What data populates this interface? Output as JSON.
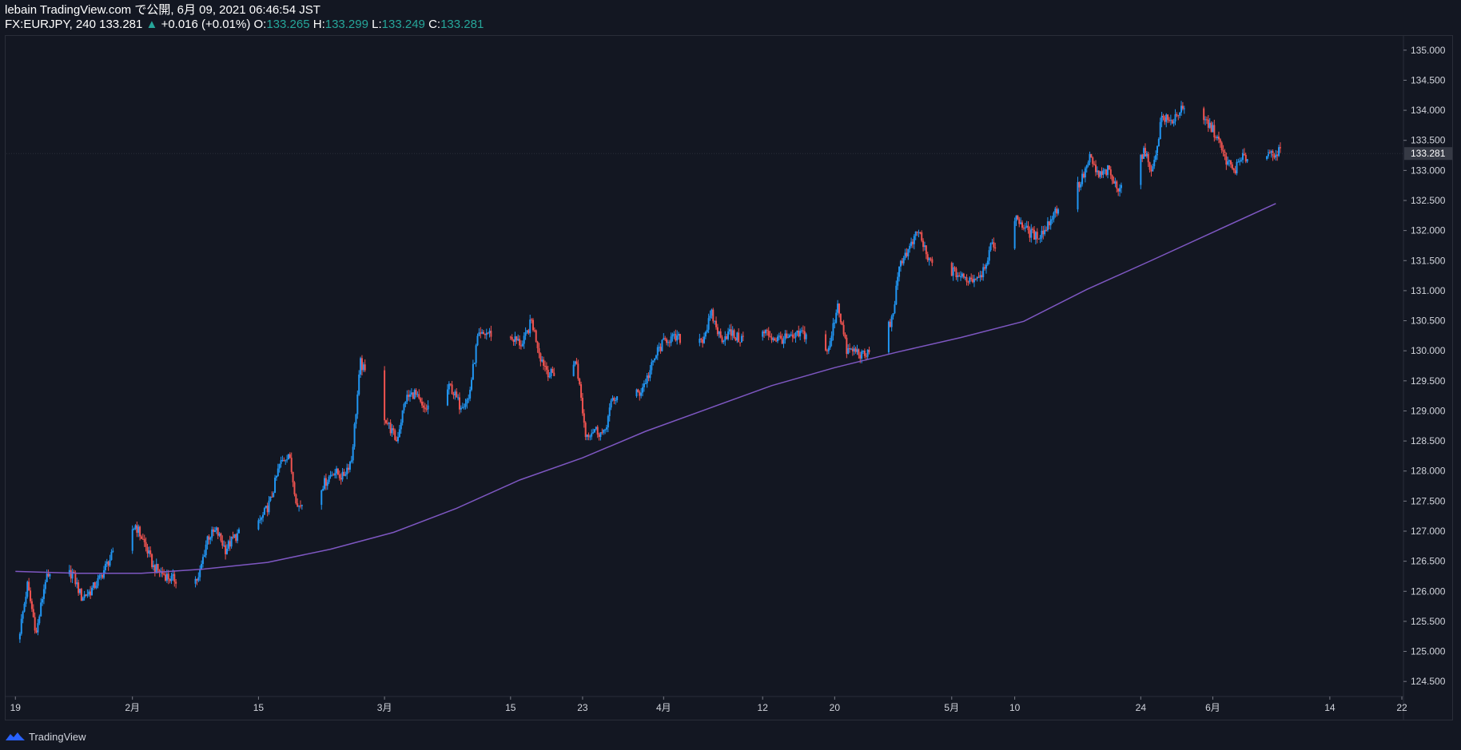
{
  "header": {
    "publish_line": "lebain TradingView.com で公開, 6月 09, 2021 06:46:54 JST",
    "symbol": "FX:EURJPY, 240",
    "last": "133.281",
    "change_arrow": "▲",
    "change": "+0.016 (+0.01%)",
    "o_label": "O:",
    "o_value": "133.265",
    "h_label": "H:",
    "h_value": "133.299",
    "l_label": "L:",
    "l_value": "133.249",
    "c_label": "C:",
    "c_value": "133.281"
  },
  "footer": {
    "brand": "TradingView",
    "logo_icon": "tradingview-logo-icon"
  },
  "colors": {
    "background": "#131722",
    "up": "#2196f3",
    "down": "#ef5350",
    "ma": "#7e57c2",
    "grid": "#1e222d",
    "text": "#d1d4dc",
    "price_label_bg": "#363a45"
  },
  "chart_data": {
    "type": "candlestick",
    "symbol": "FX:EURJPY",
    "timeframe": "240",
    "ylim": [
      124.25,
      135.25
    ],
    "y_ticks": [
      "135.000",
      "134.500",
      "134.000",
      "133.500",
      "133.000",
      "132.500",
      "132.000",
      "131.500",
      "131.000",
      "130.500",
      "130.000",
      "129.500",
      "129.000",
      "128.500",
      "128.000",
      "127.500",
      "127.000",
      "126.500",
      "126.000",
      "125.500",
      "125.000",
      "124.500"
    ],
    "x_ticks": [
      "19",
      "2月",
      "15",
      "3月",
      "15",
      "23",
      "4月",
      "12",
      "20",
      "5月",
      "10",
      "24",
      "6月",
      "14",
      "22"
    ],
    "current_price": "133.281",
    "price_path": [
      [
        "2021-01-19",
        125.2
      ],
      [
        "2021-01-20",
        126.1
      ],
      [
        "2021-01-21",
        125.3
      ],
      [
        "2021-01-22",
        126.2
      ],
      [
        "2021-01-25",
        126.3
      ],
      [
        "2021-01-26",
        125.9
      ],
      [
        "2021-01-27",
        126.0
      ],
      [
        "2021-01-28",
        126.2
      ],
      [
        "2021-01-29",
        126.5
      ],
      [
        "2021-02-01",
        127.1
      ],
      [
        "2021-02-02",
        126.8
      ],
      [
        "2021-02-03",
        126.4
      ],
      [
        "2021-02-04",
        126.3
      ],
      [
        "2021-02-05",
        126.2
      ],
      [
        "2021-02-08",
        126.2
      ],
      [
        "2021-02-09",
        126.9
      ],
      [
        "2021-02-10",
        127.0
      ],
      [
        "2021-02-11",
        126.7
      ],
      [
        "2021-02-12",
        126.9
      ],
      [
        "2021-02-15",
        127.2
      ],
      [
        "2021-02-16",
        127.5
      ],
      [
        "2021-02-17",
        128.1
      ],
      [
        "2021-02-18",
        128.3
      ],
      [
        "2021-02-19",
        127.4
      ],
      [
        "2021-02-22",
        127.8
      ],
      [
        "2021-02-23",
        128.0
      ],
      [
        "2021-02-24",
        127.9
      ],
      [
        "2021-02-25",
        128.2
      ],
      [
        "2021-02-26",
        129.8
      ],
      [
        "2021-03-01",
        128.8
      ],
      [
        "2021-03-02",
        128.5
      ],
      [
        "2021-03-03",
        129.2
      ],
      [
        "2021-03-04",
        129.3
      ],
      [
        "2021-03-05",
        129.0
      ],
      [
        "2021-03-08",
        129.4
      ],
      [
        "2021-03-09",
        129.1
      ],
      [
        "2021-03-10",
        129.2
      ],
      [
        "2021-03-11",
        130.2
      ],
      [
        "2021-03-12",
        130.3
      ],
      [
        "2021-03-15",
        130.2
      ],
      [
        "2021-03-16",
        130.1
      ],
      [
        "2021-03-17",
        130.5
      ],
      [
        "2021-03-18",
        129.9
      ],
      [
        "2021-03-19",
        129.6
      ],
      [
        "2021-03-22",
        129.8
      ],
      [
        "2021-03-23",
        128.6
      ],
      [
        "2021-03-24",
        128.7
      ],
      [
        "2021-03-25",
        128.6
      ],
      [
        "2021-03-26",
        129.2
      ],
      [
        "2021-03-29",
        129.3
      ],
      [
        "2021-03-30",
        129.6
      ],
      [
        "2021-03-31",
        130.0
      ],
      [
        "2021-04-01",
        130.2
      ],
      [
        "2021-04-02",
        130.2
      ],
      [
        "2021-04-05",
        130.2
      ],
      [
        "2021-04-06",
        130.6
      ],
      [
        "2021-04-07",
        130.2
      ],
      [
        "2021-04-08",
        130.3
      ],
      [
        "2021-04-09",
        130.2
      ],
      [
        "2021-04-12",
        130.3
      ],
      [
        "2021-04-13",
        130.2
      ],
      [
        "2021-04-14",
        130.2
      ],
      [
        "2021-04-15",
        130.2
      ],
      [
        "2021-04-16",
        130.3
      ],
      [
        "2021-04-19",
        130.0
      ],
      [
        "2021-04-20",
        130.8
      ],
      [
        "2021-04-21",
        130.0
      ],
      [
        "2021-04-22",
        130.0
      ],
      [
        "2021-04-23",
        129.9
      ],
      [
        "2021-04-26",
        130.5
      ],
      [
        "2021-04-27",
        131.5
      ],
      [
        "2021-04-28",
        131.7
      ],
      [
        "2021-04-29",
        132.0
      ],
      [
        "2021-04-30",
        131.5
      ],
      [
        "2021-05-03",
        131.3
      ],
      [
        "2021-05-04",
        131.2
      ],
      [
        "2021-05-05",
        131.2
      ],
      [
        "2021-05-06",
        131.3
      ],
      [
        "2021-05-07",
        131.7
      ],
      [
        "2021-05-10",
        132.2
      ],
      [
        "2021-05-11",
        132.0
      ],
      [
        "2021-05-12",
        131.9
      ],
      [
        "2021-05-13",
        132.0
      ],
      [
        "2021-05-14",
        132.3
      ],
      [
        "2021-05-17",
        132.8
      ],
      [
        "2021-05-18",
        133.2
      ],
      [
        "2021-05-19",
        132.9
      ],
      [
        "2021-05-20",
        133.0
      ],
      [
        "2021-05-21",
        132.7
      ],
      [
        "2021-05-24",
        133.3
      ],
      [
        "2021-05-25",
        133.0
      ],
      [
        "2021-05-26",
        133.9
      ],
      [
        "2021-05-27",
        133.8
      ],
      [
        "2021-05-28",
        134.0
      ],
      [
        "2021-05-31",
        133.8
      ],
      [
        "2021-06-01",
        133.6
      ],
      [
        "2021-06-02",
        133.2
      ],
      [
        "2021-06-03",
        133.0
      ],
      [
        "2021-06-04",
        133.2
      ],
      [
        "2021-06-07",
        133.3
      ],
      [
        "2021-06-08",
        133.3
      ]
    ],
    "moving_average": [
      [
        "2021-01-19",
        126.33
      ],
      [
        "2021-01-26",
        126.3
      ],
      [
        "2021-02-02",
        126.3
      ],
      [
        "2021-02-09",
        126.37
      ],
      [
        "2021-02-16",
        126.48
      ],
      [
        "2021-02-23",
        126.7
      ],
      [
        "2021-03-02",
        126.98
      ],
      [
        "2021-03-09",
        127.38
      ],
      [
        "2021-03-16",
        127.85
      ],
      [
        "2021-03-23",
        128.22
      ],
      [
        "2021-03-30",
        128.66
      ],
      [
        "2021-04-06",
        129.04
      ],
      [
        "2021-04-13",
        129.42
      ],
      [
        "2021-04-20",
        129.72
      ],
      [
        "2021-04-27",
        129.98
      ],
      [
        "2021-05-04",
        130.22
      ],
      [
        "2021-05-11",
        130.49
      ],
      [
        "2021-05-18",
        131.02
      ],
      [
        "2021-05-25",
        131.49
      ],
      [
        "2021-06-01",
        131.97
      ],
      [
        "2021-06-08",
        132.45
      ]
    ]
  }
}
